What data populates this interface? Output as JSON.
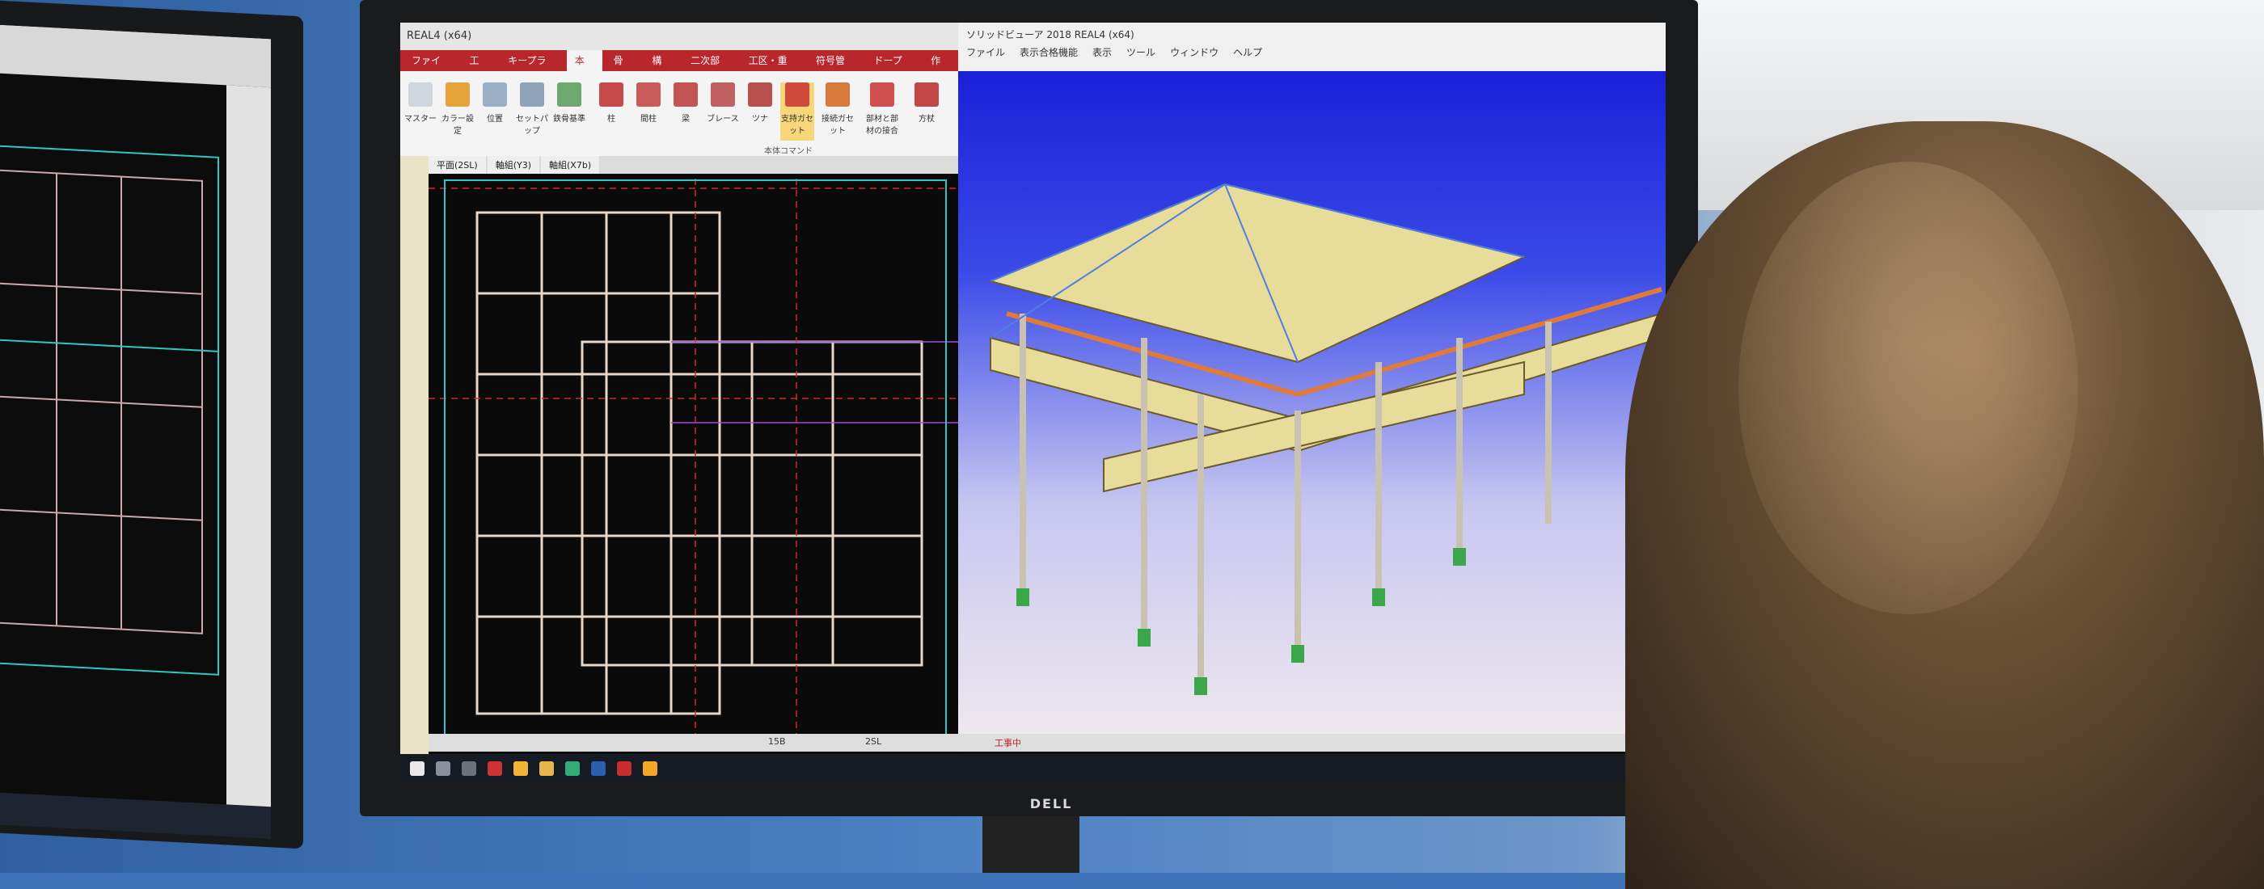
{
  "main_window": {
    "title": "REAL4 (x64)",
    "tabs": [
      "ファイル",
      "工事",
      "キープラン",
      "本体",
      "骨組",
      "構築",
      "二次部材",
      "工区・重装",
      "符号管理",
      "ドープラ",
      "作図"
    ],
    "active_tab_index": 3,
    "ribbon_buttons": [
      "マスター",
      "カラー設定",
      "位置",
      "セットパップ",
      "鉄骨基準",
      "柱",
      "間柱",
      "梁",
      "ブレース",
      "ツナ",
      "支持ガセット",
      "接続ガセット",
      "部材と部材の接合",
      "方杖"
    ],
    "ribbon_group_label": "本体コマンド",
    "cad_tabs": [
      "平面(2SL)",
      "軸組(Y3)",
      "軸組(X7b)"
    ]
  },
  "view3d_window": {
    "title": "ソリッドビューア 2018 REAL4 (x64)",
    "menu": [
      "ファイル",
      "表示合格機能",
      "表示",
      "ツール",
      "ウィンドウ",
      "ヘルプ"
    ]
  },
  "status": {
    "left": "15B",
    "middle": "2SL",
    "right": "工事中"
  },
  "brand": {
    "monitor": "DELL"
  },
  "colors": {
    "ribbon_accent": "#b9262c",
    "sky_top": "#1a20d8",
    "cad_bg": "#0a0a0a"
  }
}
